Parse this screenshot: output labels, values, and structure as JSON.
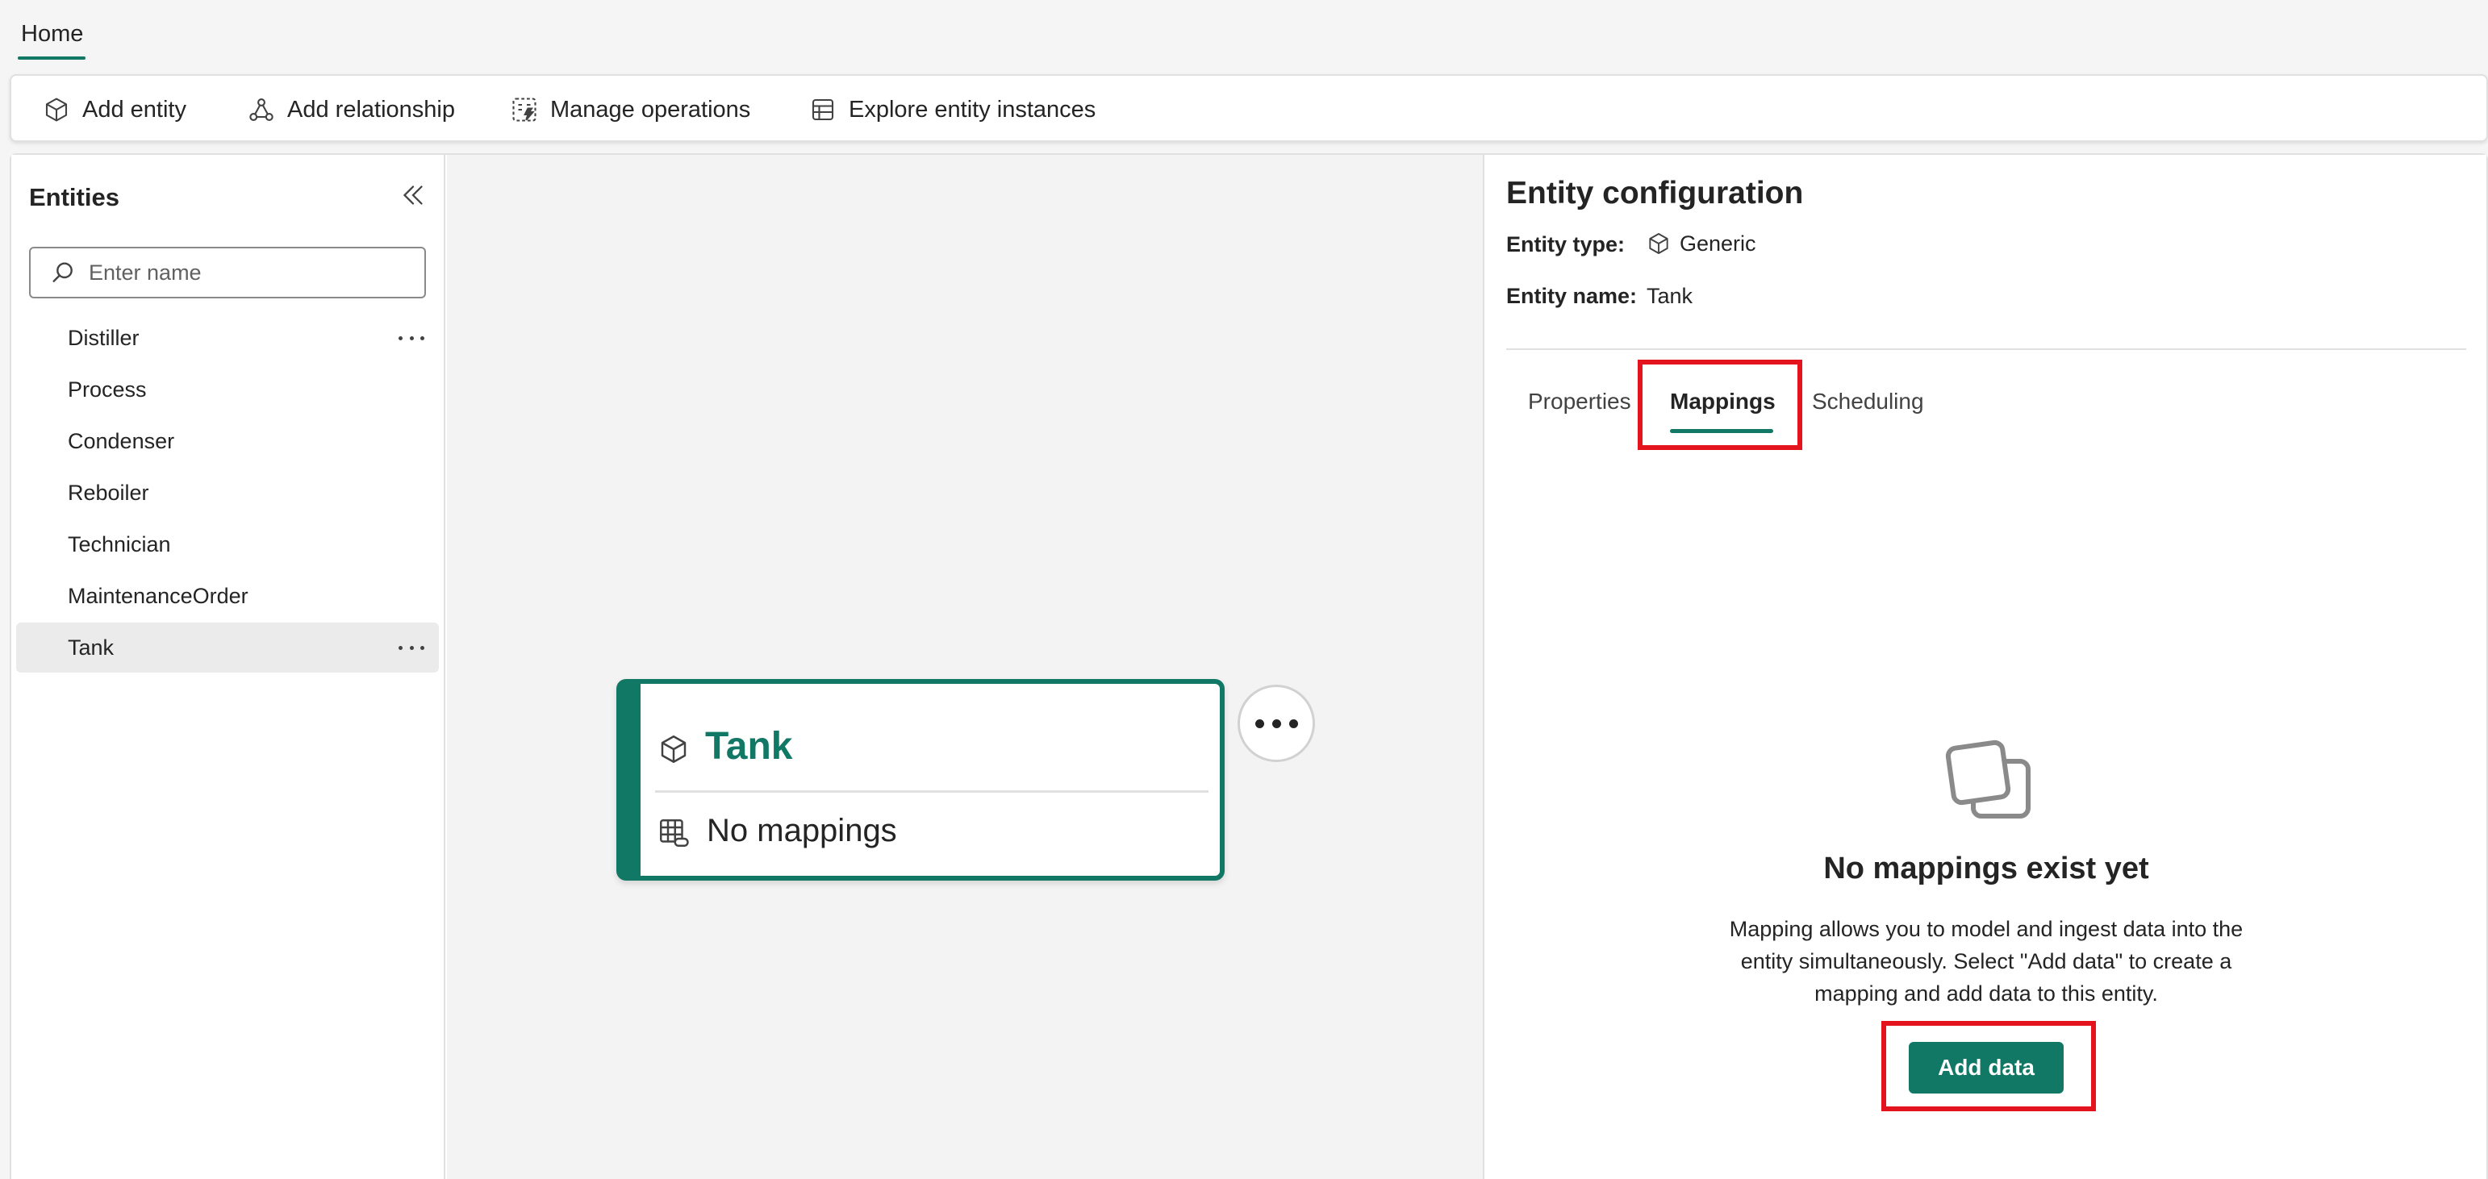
{
  "top_nav": {
    "home_tab": "Home"
  },
  "toolbar": {
    "add_entity": "Add entity",
    "add_relationship": "Add relationship",
    "manage_operations": "Manage operations",
    "explore_entity_instances": "Explore entity instances"
  },
  "sidebar": {
    "title": "Entities",
    "search_placeholder": "Enter name",
    "items": [
      {
        "label": "Distiller"
      },
      {
        "label": "Process"
      },
      {
        "label": "Condenser"
      },
      {
        "label": "Reboiler"
      },
      {
        "label": "Technician"
      },
      {
        "label": "MaintenanceOrder"
      },
      {
        "label": "Tank",
        "selected": true
      }
    ]
  },
  "canvas": {
    "card_title": "Tank",
    "card_mappings": "No mappings"
  },
  "config": {
    "title": "Entity configuration",
    "type_label": "Entity type:",
    "type_value": "Generic",
    "name_label": "Entity name:",
    "name_value": "Tank",
    "tabs": [
      {
        "label": "Properties"
      },
      {
        "label": "Mappings",
        "active": true
      },
      {
        "label": "Scheduling"
      }
    ],
    "empty_title": "No mappings exist yet",
    "empty_desc_line1": "Mapping allows you to model and ingest data into the",
    "empty_desc_line2": "entity simultaneously. Select \"Add data\" to create a",
    "empty_desc_line3": "mapping and add data to this entity.",
    "add_data_label": "Add data"
  },
  "colors": {
    "accent": "#117865",
    "highlight": "#e3141d"
  }
}
